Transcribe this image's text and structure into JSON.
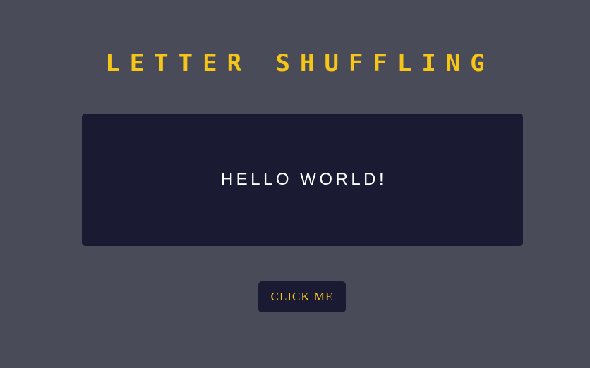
{
  "header": {
    "title": "LETTER SHUFFLING"
  },
  "display": {
    "text": "HELLO WORLD!"
  },
  "actions": {
    "click_label": "CLICK ME"
  },
  "colors": {
    "background": "#4a4b58",
    "panel": "#1a1b33",
    "accent": "#f5c518",
    "text": "#ffffff"
  }
}
